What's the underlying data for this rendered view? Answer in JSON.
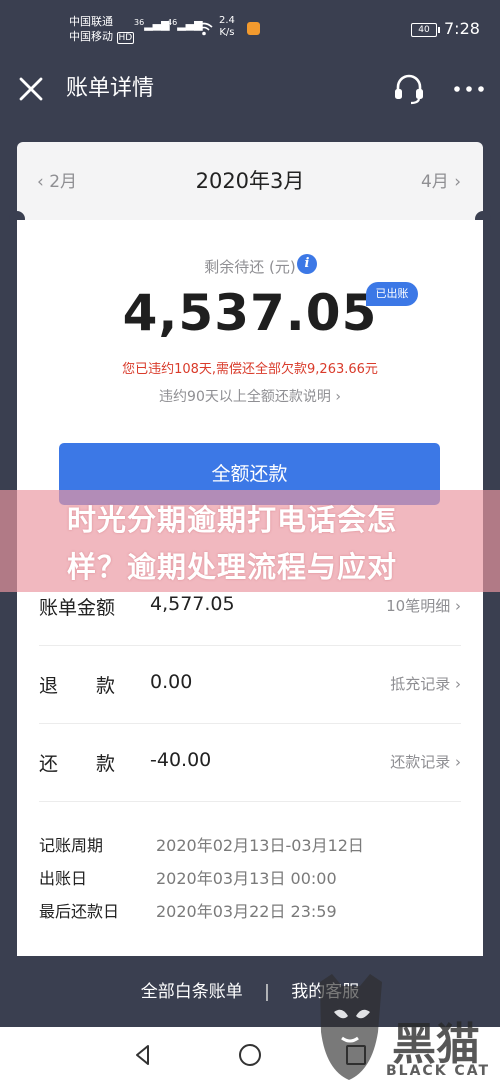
{
  "status_bar": {
    "carrier1": "中国联通",
    "carrier2": "中国移动",
    "hd": "HD",
    "sig1": "36",
    "sig2": "46",
    "speed_value": "2.4",
    "speed_unit": "K/s",
    "battery": "40",
    "time": "7:28"
  },
  "nav": {
    "title": "账单详情",
    "icons": [
      "close-icon",
      "headset-icon",
      "more-icon"
    ]
  },
  "month_selector": {
    "prev": "2月",
    "current": "2020年3月",
    "next": "4月"
  },
  "summary": {
    "remaining_label": "剩余待还 (元)",
    "amount": "4,537.05",
    "badge": "已出账",
    "overdue_message": "您已违约108天,需偿还全部欠款9,263.66元",
    "explain_link": "违约90天以上全额还款说明"
  },
  "repay_button": "全额还款",
  "watermark": {
    "line1": "时光分期逾期打电话会怎",
    "line2": "样？逾期处理流程与应对"
  },
  "rows": [
    {
      "label_a": "账单金额",
      "label_b": "",
      "value": "4,577.05",
      "link": "10笔明细"
    },
    {
      "label_a": "退",
      "label_b": "款",
      "value": "0.00",
      "link": "抵充记录"
    },
    {
      "label_a": "还",
      "label_b": "款",
      "value": "-40.00",
      "link": "还款记录"
    }
  ],
  "details": [
    {
      "label": "记账周期",
      "value": "2020年02月13日-03月12日"
    },
    {
      "label": "出账日",
      "value": "2020年03月13日 00:00"
    },
    {
      "label": "最后还款日",
      "value": "2020年03月22日 23:59"
    }
  ],
  "footer": {
    "all_bills": "全部白条账单",
    "separator": "|",
    "service": "我的客服"
  },
  "logo": {
    "big": "黑猫",
    "sub": "BLACK CAT"
  },
  "colors": {
    "header_bg": "#3a3f50",
    "accent": "#3c78e6",
    "danger": "#d93b2b",
    "muted": "#8f8f93"
  }
}
